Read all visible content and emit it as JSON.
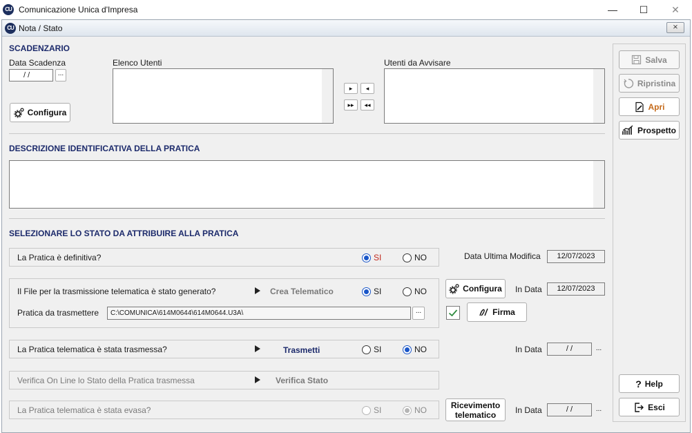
{
  "app": {
    "title": "Comunicazione Unica d'Impresa",
    "logo_text": "CU"
  },
  "window_controls": {
    "minimize": "—",
    "maximize": "☐",
    "close": "✕"
  },
  "dialog": {
    "title": "Nota / Stato",
    "close": "⨯"
  },
  "scadenzario": {
    "title": "SCADENZARIO",
    "data_scadenza_label": "Data Scadenza",
    "data_scadenza_value": " /  /",
    "ellipsis": "...",
    "configura_label": "Configura",
    "elenco_utenti_label": "Elenco Utenti",
    "utenti_avvisare_label": "Utenti da Avvisare",
    "move_one_right": "▸",
    "move_one_left": "◂",
    "move_all_right": "▸▸",
    "move_all_left": "◂◂"
  },
  "descrizione": {
    "title": "DESCRIZIONE IDENTIFICATIVA DELLA PRATICA"
  },
  "stato": {
    "title": "SELEZIONARE LO STATO DA ATTRIBUIRE ALLA PRATICA",
    "si": "SI",
    "no": "NO",
    "definitiva": {
      "question": "La Pratica è definitiva?",
      "selected": "SI"
    },
    "data_ultima_modifica_label": "Data Ultima Modifica",
    "data_ultima_modifica_value": "12/07/2023",
    "file_generato": {
      "question": "Il File per la trasmissione telematica è stato generato?",
      "action": "Crea Telematico",
      "selected": "SI",
      "configura_label": "Configura",
      "in_data_label": "In Data",
      "in_data_value": "12/07/2023",
      "pratica_label": "Pratica da trasmettere",
      "pratica_path": "C:\\COMUNICA\\614M0644\\614M0644.U3A\\",
      "firma_label": "Firma",
      "firma_checked": true
    },
    "trasmessa": {
      "question": "La Pratica telematica è stata trasmessa?",
      "action": "Trasmetti",
      "selected": "NO",
      "in_data_label": "In Data",
      "in_data_value": " /  /"
    },
    "verifica": {
      "question": "Verifica On Line lo Stato della Pratica trasmessa",
      "action": "Verifica Stato"
    },
    "evasa": {
      "question": "La Pratica telematica è stata evasa?",
      "selected": "NO",
      "ricevimento_line1": "Ricevimento",
      "ricevimento_line2": "telematico",
      "in_data_label": "In Data",
      "in_data_value": " /  /"
    }
  },
  "sidebar": {
    "salva": "Salva",
    "ripristina": "Ripristina",
    "apri": "Apri",
    "prospetto": "Prospetto",
    "help": "Help",
    "esci": "Esci"
  },
  "colors": {
    "section_title": "#1c2a6b",
    "accent_blue": "#1a56c8",
    "apri_orange": "#c56a1a",
    "si_red": "#c0281d"
  }
}
